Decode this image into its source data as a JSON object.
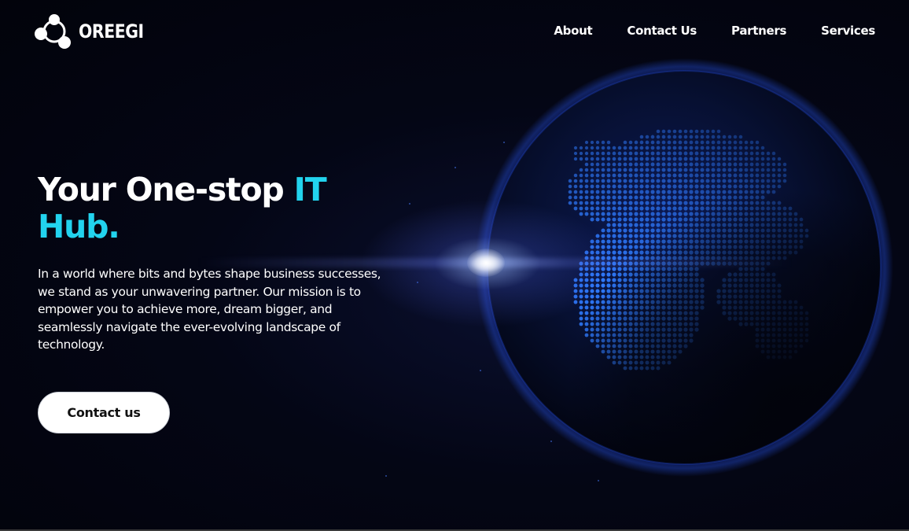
{
  "brand": {
    "name": "OREEGI",
    "logo_icon": "connected-nodes-icon"
  },
  "nav": {
    "items": [
      {
        "label": "About"
      },
      {
        "label": "Contact Us"
      },
      {
        "label": "Partners"
      },
      {
        "label": "Services"
      }
    ]
  },
  "hero": {
    "title_part1": "Your One-stop ",
    "title_accent1": "IT",
    "title_accent2": "Hub.",
    "description": "In a world where bits and bytes shape business successes, we stand as your unwavering partner. Our mission is to empower you to achieve more, dream bigger, and seamlessly navigate the ever-evolving landscape of technology.",
    "cta_label": "Contact us",
    "background_image": "glowing-globe-illustration"
  },
  "colors": {
    "background": "#02030d",
    "accent": "#22d3ee",
    "text": "#ffffff",
    "globe_dots": "#2f7bff",
    "button_bg": "#ffffff",
    "button_text": "#111111"
  }
}
